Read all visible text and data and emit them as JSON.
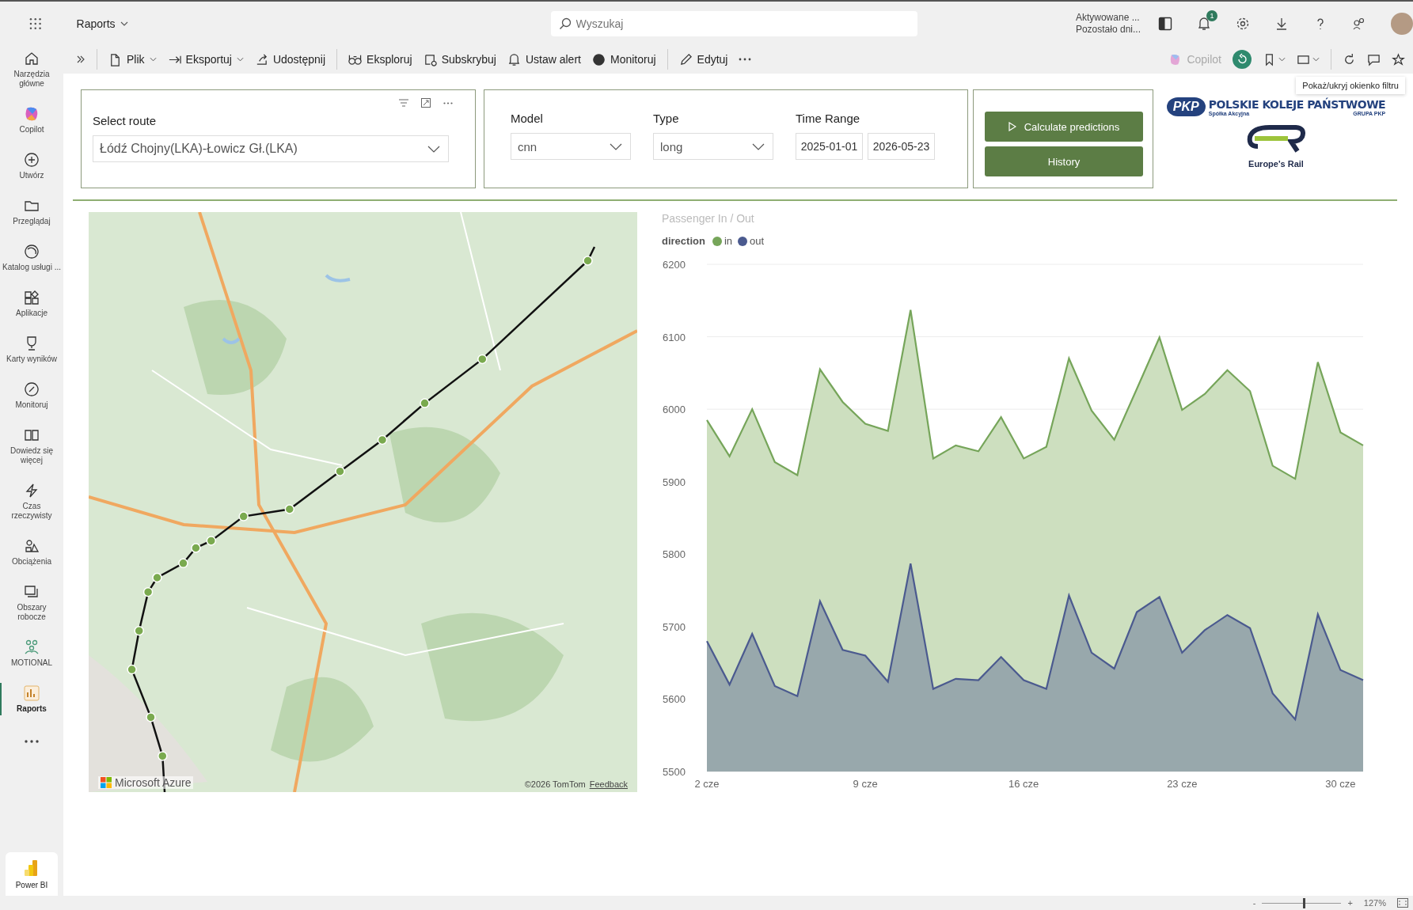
{
  "top_bar": {
    "app_name": "Raports",
    "search": {
      "placeholder": "Wyszukaj"
    },
    "trial": [
      "Aktywowane ...",
      "Pozostało dni..."
    ],
    "notification_count": "1"
  },
  "nav": [
    {
      "kind": "home",
      "label": "Narzędzia główne",
      "selected": false
    },
    {
      "kind": "copilot",
      "label": "Copilot",
      "selected": false
    },
    {
      "kind": "create",
      "label": "Utwórz",
      "selected": false
    },
    {
      "kind": "browse",
      "label": "Przeglądaj",
      "selected": false
    },
    {
      "kind": "catalog",
      "label": "Katalog usługi ...",
      "selected": false
    },
    {
      "kind": "apps",
      "label": "Aplikacje",
      "selected": false
    },
    {
      "kind": "trophy",
      "label": "Karty wyników",
      "selected": false
    },
    {
      "kind": "monitor",
      "label": "Monitoruj",
      "selected": false
    },
    {
      "kind": "book",
      "label": "Dowiedz się więcej",
      "selected": false
    },
    {
      "kind": "lightning",
      "label": "Czas rzeczywisty",
      "selected": false
    },
    {
      "kind": "workload",
      "label": "Obciążenia",
      "selected": false
    },
    {
      "kind": "workspace",
      "label": "Obszary robocze",
      "selected": false
    },
    {
      "kind": "motional",
      "label": "MOTIONAL",
      "selected": false
    },
    {
      "kind": "report",
      "label": "Raports",
      "selected": true
    }
  ],
  "power_bi": "Power BI",
  "toolbar": {
    "left": [
      {
        "kind": "file",
        "label": "Plik",
        "dropdown": true
      },
      {
        "kind": "export",
        "label": "Eksportuj",
        "dropdown": true
      },
      {
        "kind": "share",
        "label": "Udostępnij",
        "dropdown": false
      },
      {
        "kind": "explore",
        "label": "Eksploruj",
        "dropdown": false
      },
      {
        "kind": "subscribe",
        "label": "Subskrybuj",
        "dropdown": false
      },
      {
        "kind": "alert",
        "label": "Ustaw alert",
        "dropdown": false
      },
      {
        "kind": "monitor",
        "label": "Monitoruj",
        "dropdown": false
      },
      {
        "kind": "edit",
        "label": "Edytuj",
        "dropdown": false
      }
    ],
    "right": [
      {
        "kind": "copilot",
        "label": "Copilot",
        "disabled": true,
        "dropdown": false
      },
      {
        "kind": "reset",
        "disabled": false,
        "dropdown": false
      },
      {
        "kind": "bookmark",
        "disabled": false,
        "dropdown": true
      },
      {
        "kind": "view",
        "disabled": false,
        "dropdown": true
      },
      {
        "kind": "refresh",
        "disabled": false,
        "dropdown": false
      },
      {
        "kind": "comment",
        "disabled": false,
        "dropdown": false
      },
      {
        "kind": "star",
        "disabled": false,
        "dropdown": false
      }
    ]
  },
  "tooltip": "Pokaż/ukryj okienko filtru",
  "route_filter": {
    "label": "Select route",
    "value": "Łódź Chojny(LKA)-Łowicz Gł.(LKA)"
  },
  "filters": [
    {
      "kind": "dropdown",
      "label": "Model",
      "value": "cnn"
    },
    {
      "kind": "dropdown",
      "label": "Type",
      "value": "long"
    },
    {
      "kind": "dates",
      "label": "Time Range",
      "values": [
        "2025-01-01",
        "2026-05-23"
      ]
    }
  ],
  "actions": [
    {
      "kind": "play",
      "label": "Calculate predictions"
    },
    {
      "kind": "plain",
      "label": "History"
    }
  ],
  "logos": {
    "pkp": {
      "mark": "PKP",
      "name": "POLSKIE KOLEJE PAŃSTWOWE",
      "sub_left": "Spółka Akcyjna",
      "sub_right": "GRUPA PKP"
    },
    "europes_rail": "Europe's Rail"
  },
  "map": {
    "attribution": "Microsoft Azure",
    "copyright": "©2026 TomTom",
    "feedback": "Feedback"
  },
  "chart": {
    "legend_title": "direction",
    "chart_data": {
      "type": "area",
      "title": "Passenger In / Out",
      "x": [
        2,
        3,
        4,
        5,
        6,
        7,
        8,
        9,
        10,
        11,
        12,
        13,
        14,
        15,
        16,
        17,
        18,
        19,
        20,
        21,
        22,
        23,
        24,
        25,
        26,
        27,
        28,
        29,
        30,
        31
      ],
      "series": [
        {
          "name": "in",
          "color": "#76a55a",
          "values": [
            5985,
            5935,
            6000,
            5927,
            5909,
            6055,
            6010,
            5980,
            5970,
            6137,
            5932,
            5950,
            5942,
            5989,
            5932,
            5948,
            6070,
            5998,
            5958,
            6028,
            6099,
            5999,
            6021,
            6054,
            6025,
            5922,
            5904,
            6065,
            5968,
            5950
          ]
        },
        {
          "name": "out",
          "color": "#4b5a8f",
          "values": [
            5680,
            5620,
            5690,
            5618,
            5604,
            5735,
            5668,
            5660,
            5624,
            5787,
            5614,
            5628,
            5626,
            5658,
            5626,
            5614,
            5743,
            5664,
            5642,
            5720,
            5741,
            5664,
            5695,
            5716,
            5698,
            5608,
            5572,
            5717,
            5640,
            5626
          ]
        }
      ],
      "ylim": [
        5500,
        6200
      ],
      "yticks": [
        5500,
        5600,
        5700,
        5800,
        5900,
        6000,
        6100,
        6200
      ],
      "xlim": [
        2,
        31
      ],
      "grid": true,
      "xticks": [
        {
          "value": 2,
          "label": "2 cze"
        },
        {
          "value": 9,
          "label": "9 cze"
        },
        {
          "value": 16,
          "label": "16 cze"
        },
        {
          "value": 23,
          "label": "23 cze"
        },
        {
          "value": 30,
          "label": "30 cze"
        }
      ]
    }
  },
  "status_bar": {
    "zoom_out": "-",
    "zoom_in": "+",
    "level": 0.52,
    "zoom": "127%"
  }
}
